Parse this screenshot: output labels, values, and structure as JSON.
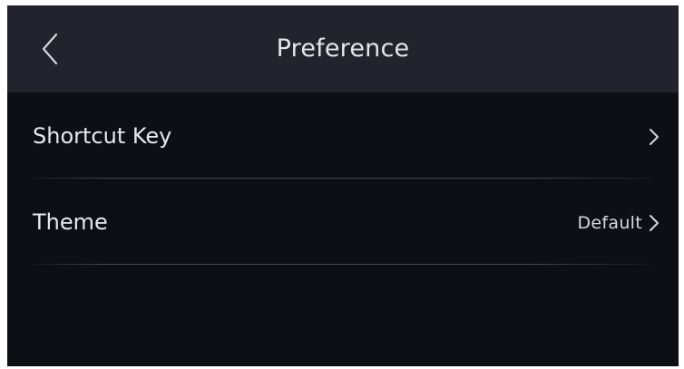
{
  "header": {
    "title": "Preference",
    "back_icon": "chevron-left-icon"
  },
  "list": {
    "items": [
      {
        "label": "Shortcut Key",
        "value": "",
        "icon": "chevron-right-icon"
      },
      {
        "label": "Theme",
        "value": "Default",
        "icon": "chevron-right-icon"
      }
    ]
  },
  "colors": {
    "header_bg": "#23232e",
    "body_bg": "#0e0e15",
    "text": "#e8e8ec",
    "divider": "#4e4e5c"
  }
}
